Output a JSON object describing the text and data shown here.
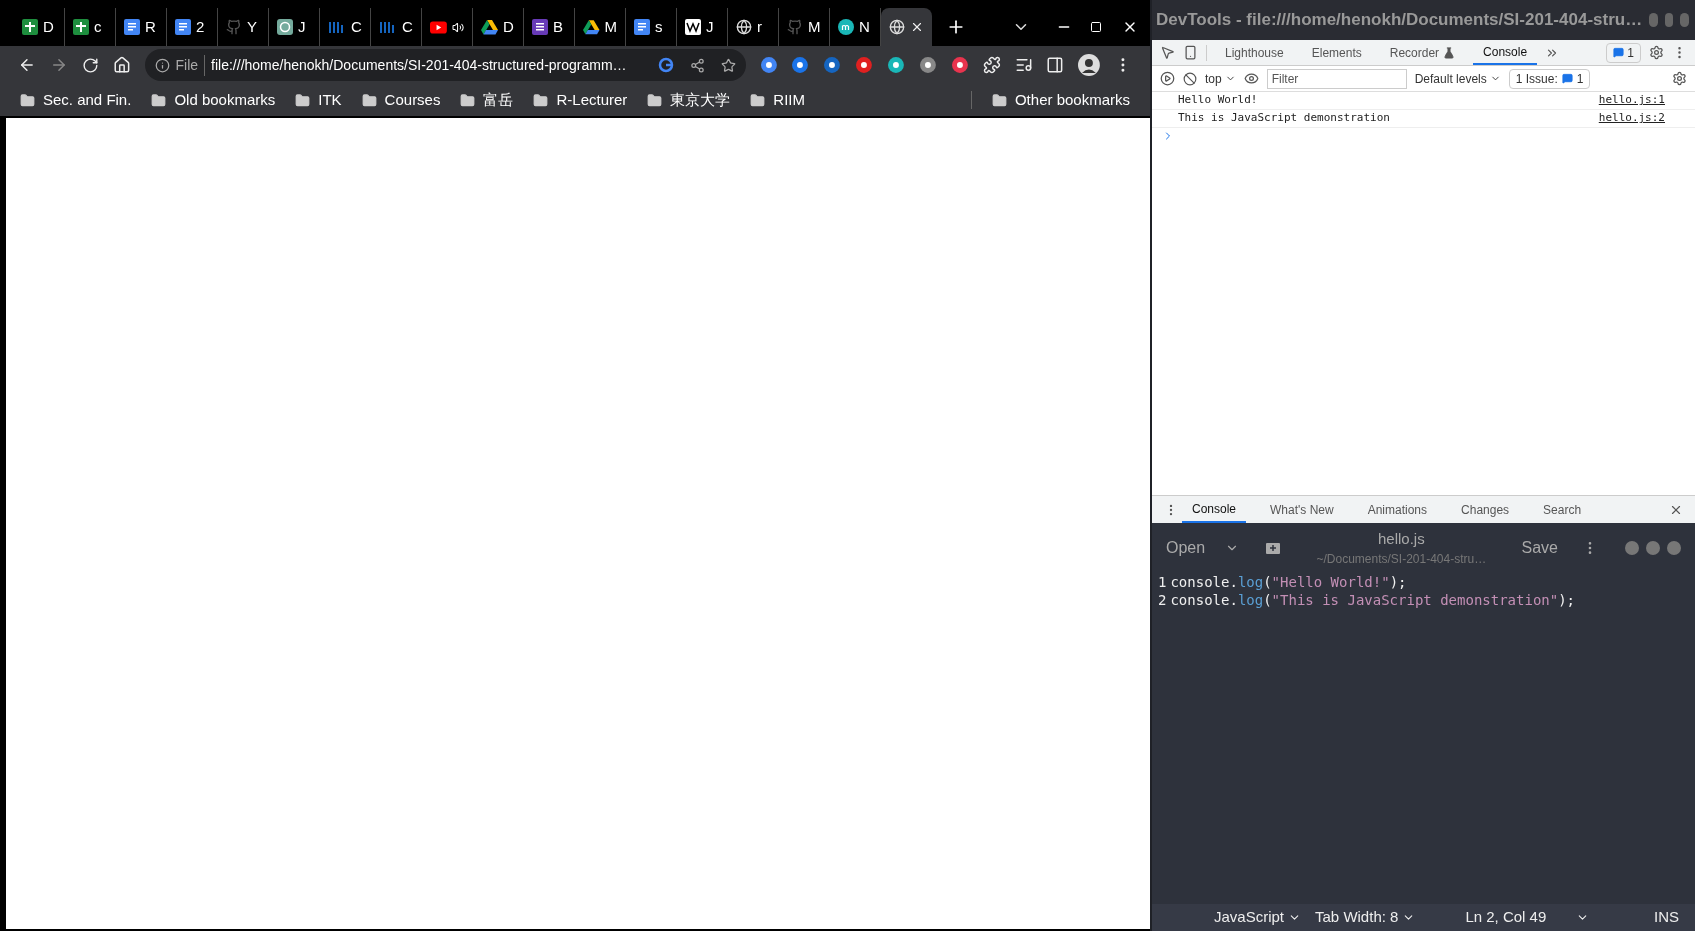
{
  "browser": {
    "tabs": [
      {
        "kind": "sheets",
        "label": "D",
        "selected": false,
        "audible": false
      },
      {
        "kind": "sheets",
        "label": "c",
        "selected": false,
        "audible": false
      },
      {
        "kind": "docs",
        "label": "R",
        "selected": false,
        "audible": false
      },
      {
        "kind": "docs",
        "label": "2",
        "selected": false,
        "audible": false
      },
      {
        "kind": "github",
        "label": "Y",
        "selected": false,
        "audible": false
      },
      {
        "kind": "chatgpt",
        "label": "J",
        "selected": false,
        "audible": false
      },
      {
        "kind": "itk",
        "label": "C",
        "selected": false,
        "audible": false
      },
      {
        "kind": "itk",
        "label": "C",
        "selected": false,
        "audible": false
      },
      {
        "kind": "youtube",
        "selected": false,
        "audible": true
      },
      {
        "kind": "drive",
        "label": "D",
        "selected": false,
        "audible": false
      },
      {
        "kind": "forms",
        "label": "B",
        "selected": false,
        "audible": false
      },
      {
        "kind": "drive",
        "label": "M",
        "selected": false,
        "audible": false
      },
      {
        "kind": "docs",
        "label": "s",
        "selected": false,
        "audible": false
      },
      {
        "kind": "wiki",
        "label": "J",
        "selected": false,
        "audible": false
      },
      {
        "kind": "globe",
        "label": "r",
        "selected": false,
        "audible": false
      },
      {
        "kind": "github",
        "label": "M",
        "selected": false,
        "audible": false
      },
      {
        "kind": "mcircle",
        "label": "N",
        "selected": false,
        "audible": false
      },
      {
        "kind": "globe",
        "selected": true,
        "audible": false
      }
    ],
    "address": {
      "scheme": "File",
      "url": "file:///home/henokh/Documents/SI-201-404-structured-programm…"
    },
    "bookmarks": [
      "Sec. and Fin.",
      "Old bookmarks",
      "ITK",
      "Courses",
      "富岳",
      "R-Lecturer",
      "東京大学",
      "RIIM"
    ],
    "other_bookmarks": "Other bookmarks"
  },
  "devtools": {
    "title": "DevTools - file:///home/henokh/Documents/SI-201-404-stru…",
    "tabs": [
      {
        "label": "Lighthouse",
        "selected": false
      },
      {
        "label": "Elements",
        "selected": false
      },
      {
        "label": "Recorder",
        "selected": false
      },
      {
        "label": "Console",
        "selected": true
      }
    ],
    "messages_badge": "1",
    "context": "top",
    "filter_placeholder": "Filter",
    "levels": "Default levels",
    "issues_label": "1 Issue:",
    "issues_count": "1",
    "messages": [
      {
        "text": "Hello World!",
        "source": "hello.js:1"
      },
      {
        "text": "This is JavaScript demonstration",
        "source": "hello.js:2"
      }
    ],
    "drawer_tabs": [
      {
        "label": "Console",
        "selected": true
      },
      {
        "label": "What's New",
        "selected": false
      },
      {
        "label": "Animations",
        "selected": false
      },
      {
        "label": "Changes",
        "selected": false
      },
      {
        "label": "Search",
        "selected": false
      }
    ]
  },
  "editor": {
    "open": "Open",
    "filename": "hello.js",
    "path": "~/Documents/SI-201-404-stru…",
    "save": "Save",
    "lines": [
      {
        "number": "1",
        "tokens": [
          {
            "kind": "plain",
            "text": "console."
          },
          {
            "kind": "method",
            "text": "log"
          },
          {
            "kind": "plain",
            "text": "("
          },
          {
            "kind": "string",
            "text": "\"Hello World!\""
          },
          {
            "kind": "plain",
            "text": ");"
          }
        ]
      },
      {
        "number": "2",
        "tokens": [
          {
            "kind": "plain",
            "text": "console."
          },
          {
            "kind": "method",
            "text": "log"
          },
          {
            "kind": "plain",
            "text": "("
          },
          {
            "kind": "string",
            "text": "\"This is JavaScript demonstration\""
          },
          {
            "kind": "plain",
            "text": ");"
          }
        ]
      }
    ],
    "status": {
      "language": "JavaScript",
      "tab_width": "Tab Width: 8",
      "position": "Ln 2, Col 49",
      "mode": "INS"
    }
  }
}
